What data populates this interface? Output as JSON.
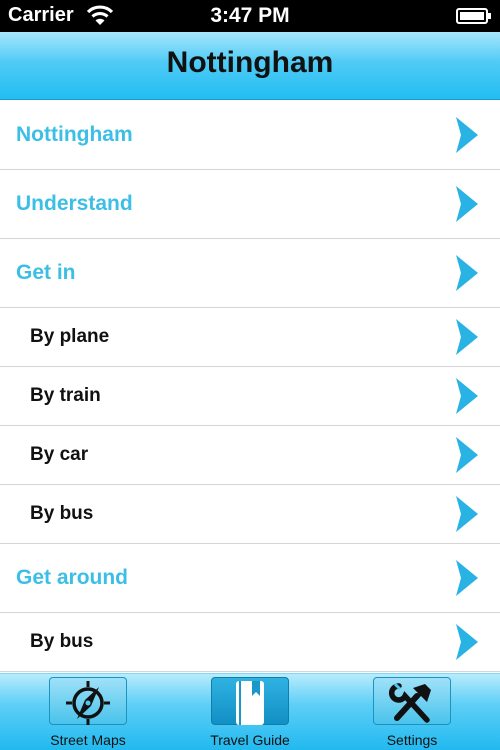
{
  "status_bar": {
    "carrier": "Carrier",
    "time": "3:47 PM"
  },
  "nav": {
    "title": "Nottingham"
  },
  "list": {
    "rows": [
      {
        "label": "Nottingham",
        "kind": "section"
      },
      {
        "label": "Understand",
        "kind": "section"
      },
      {
        "label": "Get in",
        "kind": "section"
      },
      {
        "label": "By plane",
        "kind": "sub"
      },
      {
        "label": "By train",
        "kind": "sub"
      },
      {
        "label": "By car",
        "kind": "sub"
      },
      {
        "label": "By bus",
        "kind": "sub"
      },
      {
        "label": "Get around",
        "kind": "section"
      },
      {
        "label": "By bus",
        "kind": "sub"
      }
    ]
  },
  "tab_bar": {
    "tabs": [
      {
        "label": "Street Maps",
        "icon": "compass-icon",
        "active": false
      },
      {
        "label": "Travel Guide",
        "icon": "book-icon",
        "active": true
      },
      {
        "label": "Settings",
        "icon": "tools-icon",
        "active": false
      }
    ]
  },
  "colors": {
    "section_text": "#3cbfe6",
    "sub_text": "#111111",
    "accent_blue": "#22bdf2",
    "chevron": "#29b3e5"
  }
}
